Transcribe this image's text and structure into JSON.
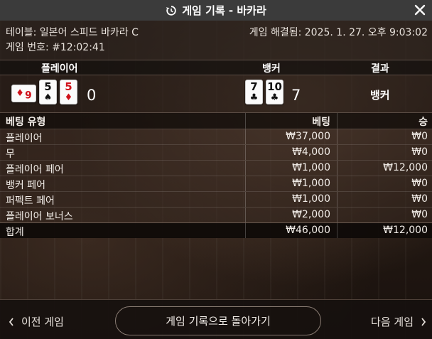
{
  "dialog": {
    "title": "게임 기록 - 바카라",
    "close_label": "✕"
  },
  "info": {
    "table_label": "테이블: 일본어 스피드 바카라 C",
    "resolved_label": "게임 해결됨: 2025. 1. 27. 오후 9:03:02",
    "game_number_label": "게임 번호: #12:02:41"
  },
  "result": {
    "headers": {
      "player": "플레이어",
      "banker": "뱅커",
      "result": "결과"
    },
    "player_cards": [
      {
        "rank": "6",
        "suit": "♦",
        "color": "red",
        "sideways": true
      },
      {
        "rank": "5",
        "suit": "♠",
        "color": "black",
        "sideways": false
      },
      {
        "rank": "5",
        "suit": "♦",
        "color": "red",
        "sideways": false
      }
    ],
    "player_score": "0",
    "banker_cards": [
      {
        "rank": "7",
        "suit": "♣",
        "color": "black",
        "sideways": false
      },
      {
        "rank": "10",
        "suit": "♣",
        "color": "black",
        "sideways": false
      }
    ],
    "banker_score": "7",
    "winner": "뱅커"
  },
  "bets": {
    "headers": {
      "type": "베팅 유형",
      "bet": "베팅",
      "win": "승"
    },
    "rows": [
      {
        "type": "플레이어",
        "bet": "₩37,000",
        "win": "₩0"
      },
      {
        "type": "무",
        "bet": "₩4,000",
        "win": "₩0"
      },
      {
        "type": "플레이어 페어",
        "bet": "₩1,000",
        "win": "₩12,000"
      },
      {
        "type": "뱅커 페어",
        "bet": "₩1,000",
        "win": "₩0"
      },
      {
        "type": "퍼펙트 페어",
        "bet": "₩1,000",
        "win": "₩0"
      },
      {
        "type": "플레이어 보너스",
        "bet": "₩2,000",
        "win": "₩0"
      }
    ],
    "total": {
      "type": "합계",
      "bet": "₩46,000",
      "win": "₩12,000"
    }
  },
  "footer": {
    "prev_label": "이전 게임",
    "back_label": "게임 기록으로 돌아가기",
    "next_label": "다음 게임"
  },
  "colors": {
    "card_red": "#d0121b",
    "card_black": "#111111",
    "titlebar": "#3b3b3b"
  }
}
